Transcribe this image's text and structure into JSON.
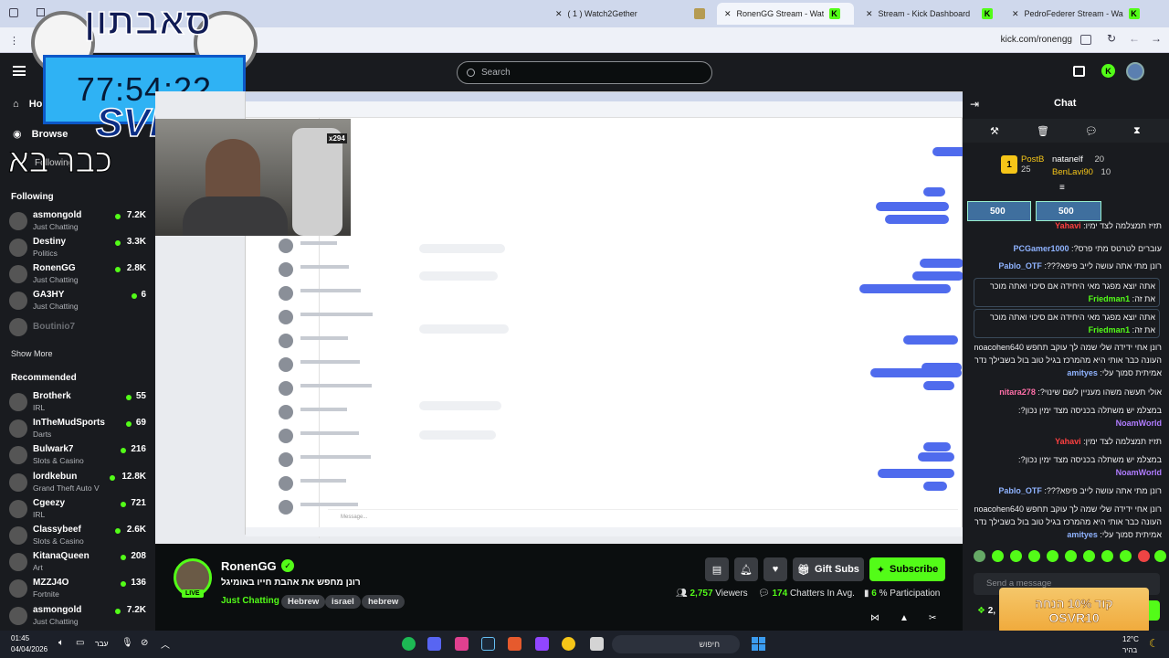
{
  "browser": {
    "tabs": [
      {
        "label": "( 1 ) Watch2Gether",
        "active": false
      },
      {
        "label": "RonenGG Stream - Watch L",
        "active": true
      },
      {
        "label": "Stream - Kick Dashboard",
        "active": false
      },
      {
        "label": "PedroFederer Stream - Watch L",
        "active": false
      }
    ],
    "url": "kick.com/ronengg"
  },
  "header": {
    "search_placeholder": "Search"
  },
  "overlay": {
    "logo_text": "סאבתון",
    "timer": "77:54:22",
    "subtext": "SVR",
    "tagline": "כבר בא"
  },
  "sidebar": {
    "home": "Home",
    "browse": "Browse",
    "following_tab": "Following",
    "following_title": "Following",
    "following": [
      {
        "name": "asmongold",
        "category": "Just Chatting",
        "viewers": "7.2K",
        "live": true
      },
      {
        "name": "Destiny",
        "category": "Politics",
        "viewers": "3.3K",
        "live": true
      },
      {
        "name": "RonenGG",
        "category": "Just Chatting",
        "viewers": "2.8K",
        "live": true
      },
      {
        "name": "GA3HY",
        "category": "Just Chatting",
        "viewers": "6",
        "live": true
      },
      {
        "name": "Boutinio7",
        "category": "",
        "viewers": "",
        "live": false
      }
    ],
    "show_more": "Show More",
    "recommended_title": "Recommended",
    "recommended": [
      {
        "name": "Brotherk",
        "category": "IRL",
        "viewers": "55"
      },
      {
        "name": "InTheMudSports",
        "category": "Darts",
        "viewers": "69"
      },
      {
        "name": "Bulwark7",
        "category": "Slots & Casino",
        "viewers": "216"
      },
      {
        "name": "lordkebun",
        "category": "Grand Theft Auto V",
        "viewers": "12.8K"
      },
      {
        "name": "Cgeezy",
        "category": "IRL",
        "viewers": "721"
      },
      {
        "name": "Classybeef",
        "category": "Slots & Casino",
        "viewers": "2.6K"
      },
      {
        "name": "KitanaQueen",
        "category": "Art",
        "viewers": "208"
      },
      {
        "name": "MZZJ4O",
        "category": "Fortnite",
        "viewers": "136"
      },
      {
        "name": "asmongold",
        "category": "Just Chatting",
        "viewers": "7.2K"
      }
    ]
  },
  "stream": {
    "channel": "RonenGG",
    "title": "רונן מחפש את אהבת חייו באומיגל",
    "category": "Just Chatting",
    "tags": [
      "Hebrew",
      "israel",
      "hebrew"
    ],
    "live_label": "LIVE",
    "gift_subs": "Gift Subs",
    "subscribe": "Subscribe",
    "viewers": "2,757",
    "viewers_label": "Viewers",
    "chatters": "174",
    "chatters_label": "Chatters In Avg.",
    "participation": "6",
    "participation_label": "% Participation",
    "cam_badge": "x294"
  },
  "chat": {
    "title": "Chat",
    "leaders": [
      {
        "name": "PostB",
        "count": "25"
      },
      {
        "name": "natanelf",
        "count": "20"
      },
      {
        "name": "BenLavi90",
        "count": "10"
      }
    ],
    "gifts": [
      "500",
      "500"
    ],
    "messages": [
      {
        "user": "Yahavi",
        "color": "#ff4040",
        "text": "תזיז תמצלמה לצד ימין",
        "highlight": false
      },
      {
        "user": "PCGamer1000",
        "color": "#8fb3ff",
        "text": "עוברים לטרטס מתי פרס?",
        "highlight": false
      },
      {
        "user": "Pablo_OTF",
        "color": "#8fb3ff",
        "text": "רונן מתי אתה עושה לייב פיפא???",
        "highlight": false
      },
      {
        "user": "Friedman1",
        "color": "#53fc18",
        "text": "אתה יוצא מפגר מאי היחידה אם סיכוי ואתה מוכר את זה",
        "highlight": true
      },
      {
        "user": "Friedman1",
        "color": "#53fc18",
        "text": "אתה יוצא מפגר מאי היחידה אם סיכוי ואתה מוכר את זה",
        "highlight": true
      },
      {
        "user": "amityes",
        "color": "#8fb3ff",
        "text": "רונן אחי ידידה שלי שמה לך עוקב תחפש noacohen640 העונה כבר אותי היא מהמרכז בגיל טוב בול בשבילך נדר אמיתית סמוך עלי",
        "highlight": false
      },
      {
        "user": "nitara278",
        "color": "#ff6fa8",
        "text": "אולי תעשה משהו מעניין לשם שינוי?",
        "highlight": false
      },
      {
        "user": "NoamWorld",
        "color": "#b07cff",
        "text": "במצלמ יש משתלה בכניסה מצד ימין נכון?",
        "highlight": false
      },
      {
        "user": "Yahavi",
        "color": "#ff4040",
        "text": "תזיז תמצלמה לצד ימין",
        "highlight": false
      },
      {
        "user": "NoamWorld",
        "color": "#b07cff",
        "text": "במצלמ יש משתלה בכניסה מצד ימין נכון?",
        "highlight": false
      },
      {
        "user": "Pablo_OTF",
        "color": "#8fb3ff",
        "text": "רונן מתי אתה עושה לייב פיפא???",
        "highlight": false
      },
      {
        "user": "amityes",
        "color": "#8fb3ff",
        "text": "רונן אחי ידידה שלי שמה לך עוקב תחפש noacohen640 העונה כבר אותי היא מהמרכז בגיל טוב בול בשבילך נדר אמיתית סמוך עלי",
        "highlight": false
      }
    ],
    "input_placeholder": "Send a message",
    "bottom_count": "2,",
    "promo_text": "קוד 10% הנחה",
    "promo_code": "OSVR10"
  },
  "taskbar": {
    "time": "01:45",
    "date": "04/04/2026",
    "lang": "עבר",
    "search": "חיפוש",
    "temp": "12°C",
    "weather": "בהיר"
  },
  "colors": {
    "kick_green": "#53fc18",
    "bg": "#0b0e0f",
    "panel": "#191b1f"
  }
}
